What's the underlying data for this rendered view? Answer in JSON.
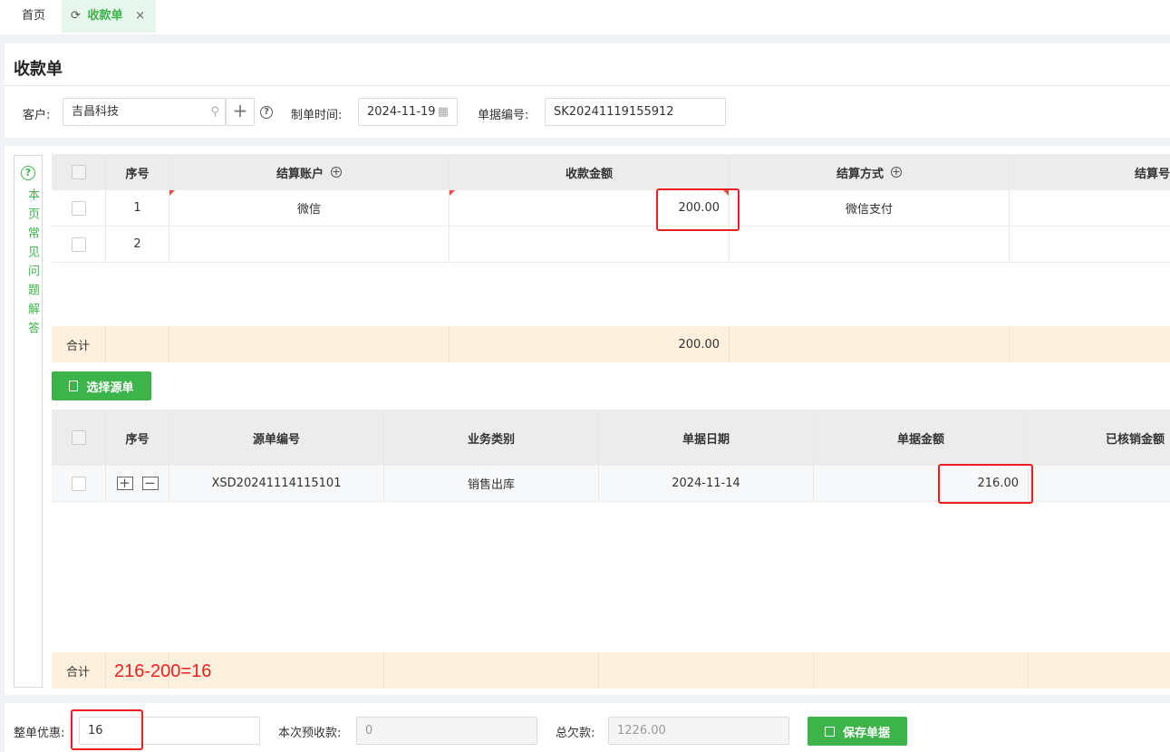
{
  "tabs": {
    "home": "首页",
    "active": "收款单"
  },
  "page": {
    "title": "收款单"
  },
  "header": {
    "customer_label": "客户:",
    "customer_value": "吉昌科技",
    "date_label": "制单时间:",
    "date_value": "2024-11-19",
    "docno_label": "单据编号:",
    "docno_value": "SK20241119155912"
  },
  "faq": {
    "text": "本页常见问题解答"
  },
  "settle_table": {
    "headers": [
      "序号",
      "结算账户",
      "收款金额",
      "结算方式",
      "结算号"
    ],
    "rows": [
      {
        "seq": "1",
        "account": "微信",
        "amount": "200.00",
        "method": "微信支付"
      },
      {
        "seq": "2",
        "account": "",
        "amount": "",
        "method": ""
      }
    ],
    "sum_label": "合计",
    "sum_amount": "200.00"
  },
  "select_source_button": "选择源单",
  "source_table": {
    "headers": [
      "序号",
      "源单编号",
      "业务类别",
      "单据日期",
      "单据金额",
      "已核销金额"
    ],
    "rows": [
      {
        "docno": "XSD20241114115101",
        "category": "销售出库",
        "date": "2024-11-14",
        "amount": "216.00"
      }
    ],
    "sum_label": "合计"
  },
  "annotation": {
    "note": "216-200=16"
  },
  "footer": {
    "discount_label": "整单优惠:",
    "discount_value": "16",
    "prepay_label": "本次预收款:",
    "prepay_value": "0",
    "debt_label": "总欠款:",
    "debt_value": "1226.00",
    "save_button": "保存单据"
  },
  "colors": {
    "accent": "#3cb44a",
    "highlight": "#ee1f1f",
    "sum_row": "#fdf0dc"
  }
}
